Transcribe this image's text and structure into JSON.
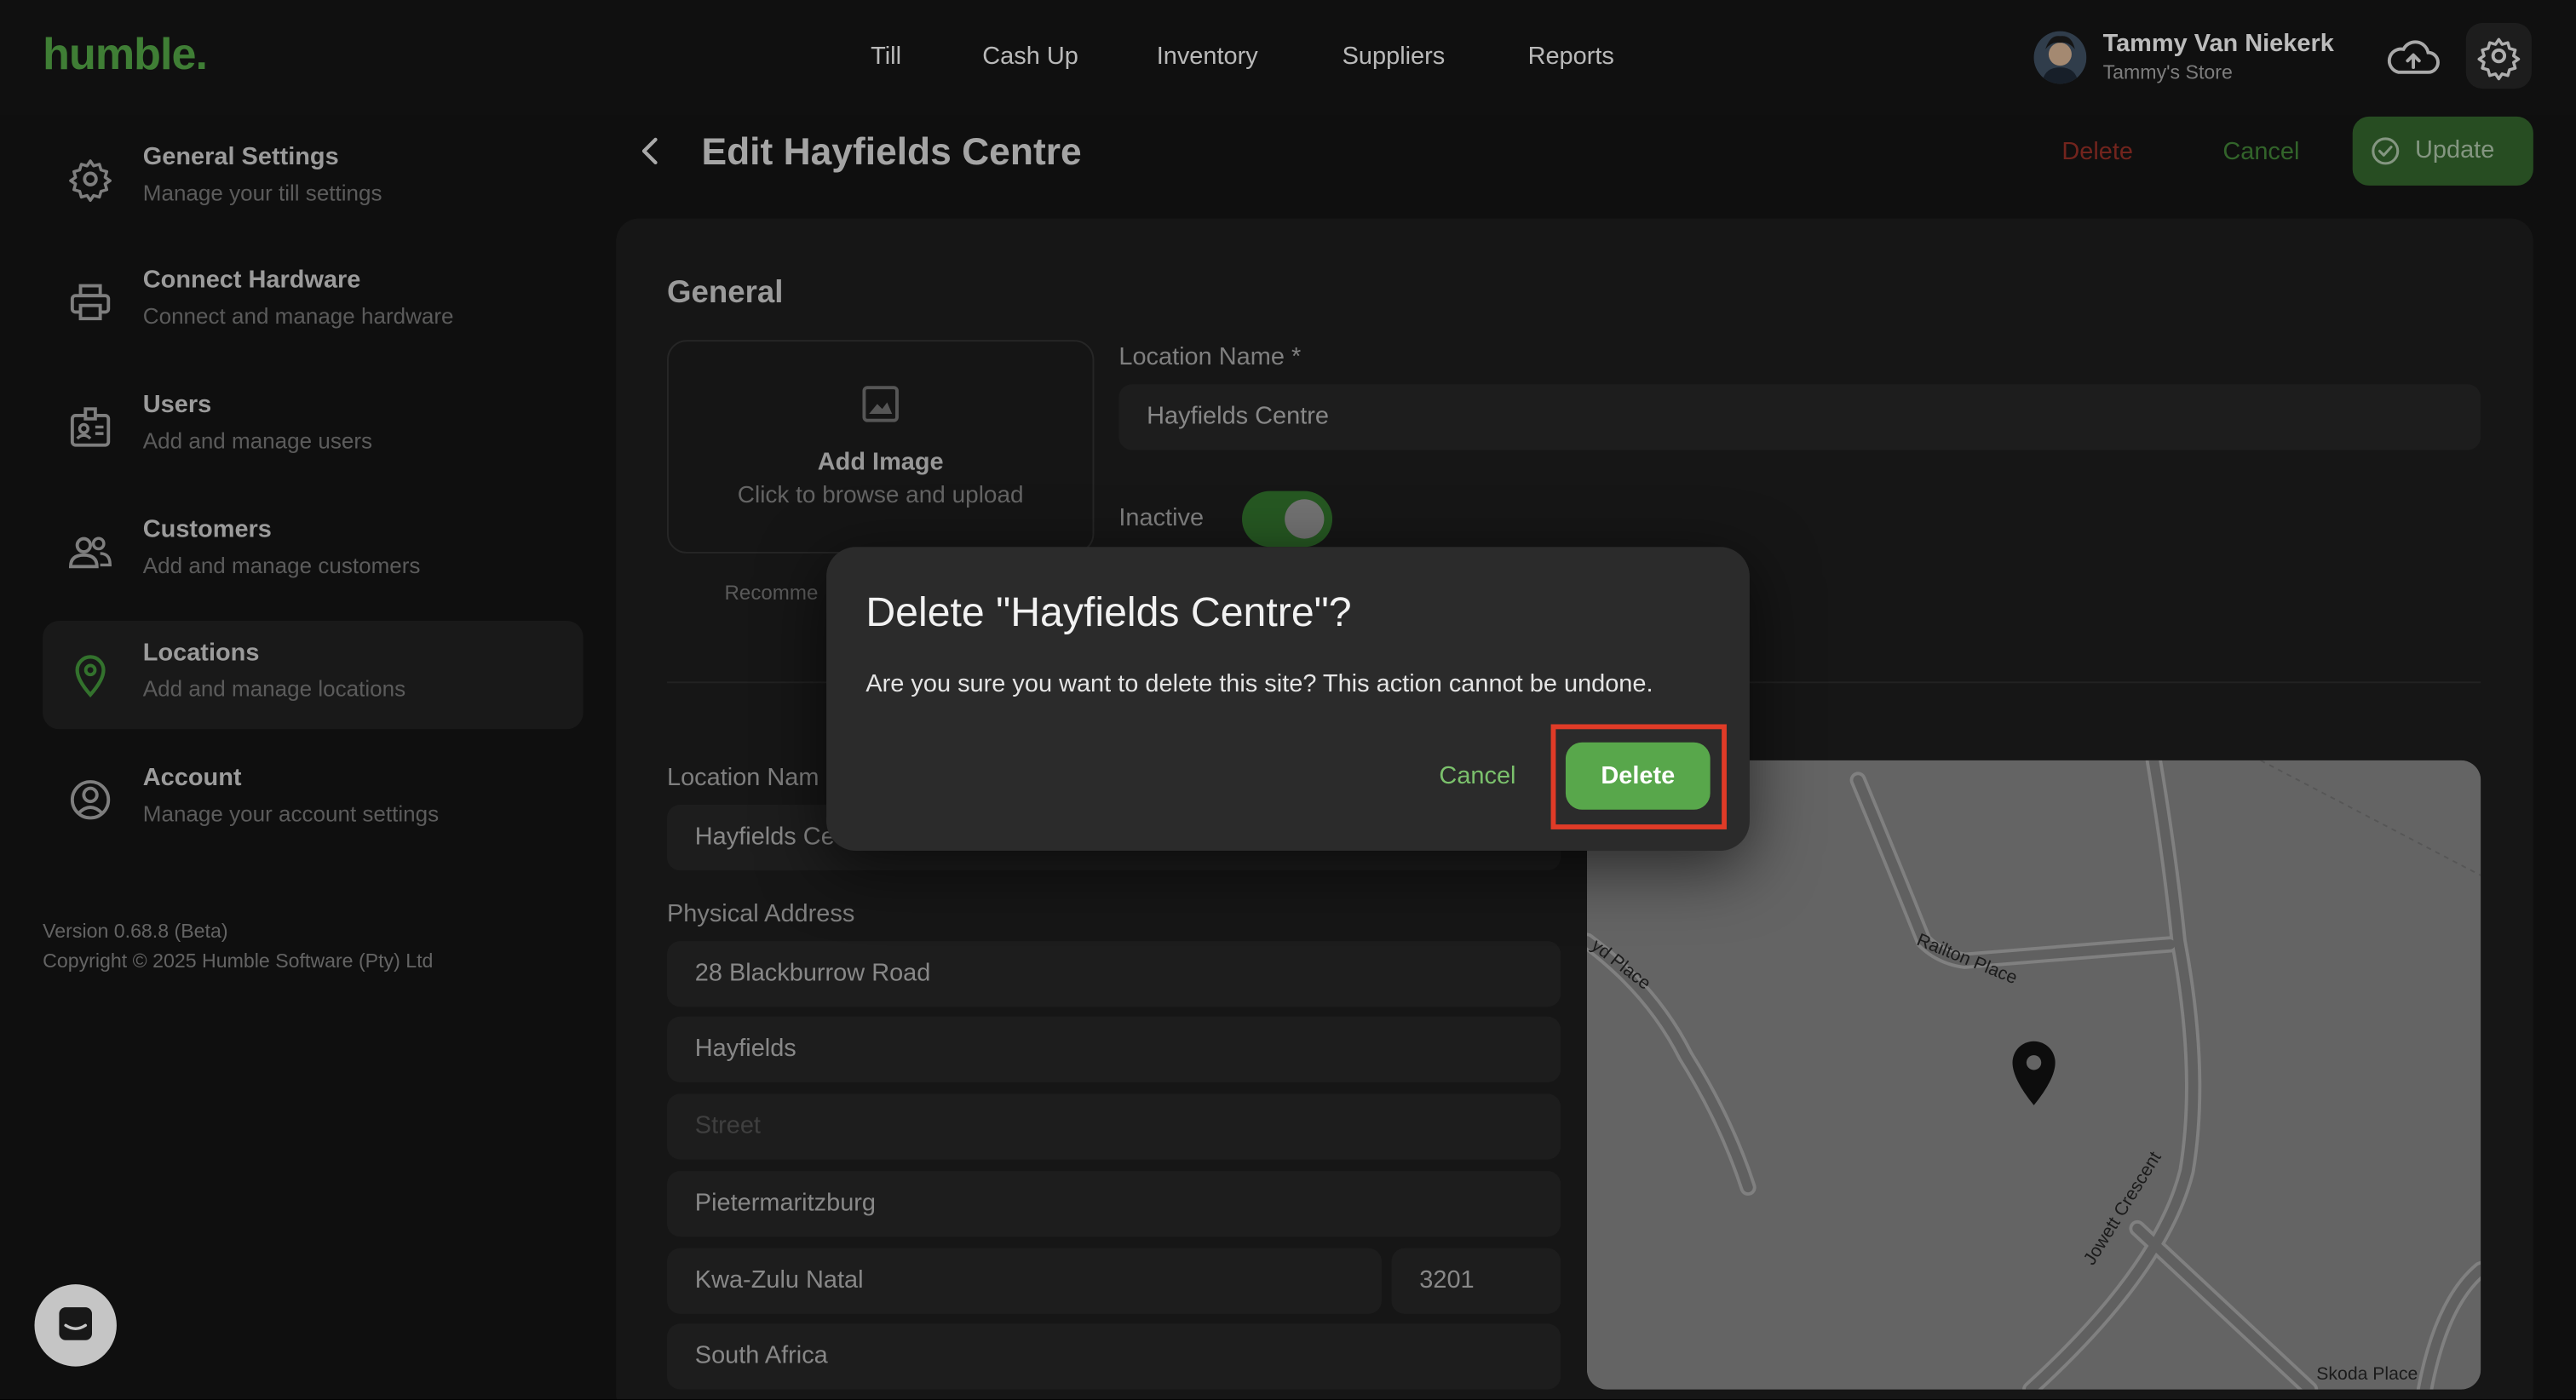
{
  "app": {
    "logo": "humble."
  },
  "nav": {
    "items": [
      "Till",
      "Cash Up",
      "Inventory",
      "Suppliers",
      "Reports"
    ]
  },
  "user": {
    "name": "Tammy Van Niekerk",
    "store": "Tammy's Store"
  },
  "sidebar": {
    "items": [
      {
        "title": "General Settings",
        "subtitle": "Manage your till settings",
        "icon": "gear-icon"
      },
      {
        "title": "Connect Hardware",
        "subtitle": "Connect and manage hardware",
        "icon": "printer-icon"
      },
      {
        "title": "Users",
        "subtitle": "Add and manage users",
        "icon": "id-card-icon"
      },
      {
        "title": "Customers",
        "subtitle": "Add and manage customers",
        "icon": "people-icon"
      },
      {
        "title": "Locations",
        "subtitle": "Add and manage locations",
        "icon": "location-pin-icon",
        "active": true
      },
      {
        "title": "Account",
        "subtitle": "Manage your account settings",
        "icon": "user-circle-icon"
      }
    ],
    "version": "Version 0.68.8 (Beta)",
    "copyright": "Copyright © 2025 Humble Software (Pty) Ltd"
  },
  "page": {
    "title": "Edit Hayfields Centre",
    "delete_label": "Delete",
    "cancel_label": "Cancel",
    "update_label": "Update"
  },
  "general": {
    "section_title": "General",
    "image_title": "Add Image",
    "image_subtitle": "Click to browse and upload",
    "recommend_text": "Recomme",
    "location_name_label": "Location Name *",
    "location_name_value": "Hayfields Centre",
    "inactive_label": "Inactive",
    "inactive_toggle": "on"
  },
  "details": {
    "location_name_label": "Location Nam",
    "location_name_value": "Hayfields Ce",
    "physical_address_label": "Physical Address",
    "address_line1": "28 Blackburrow Road",
    "suburb": "Hayfields",
    "street_placeholder": "Street",
    "city": "Pietermaritzburg",
    "province": "Kwa-Zulu Natal",
    "postal_code": "3201",
    "country": "South Africa"
  },
  "map": {
    "streets": [
      "Railton Place",
      "yd Place",
      "Jowett Crescent",
      "Skoda Place"
    ]
  },
  "dialog": {
    "title": "Delete \"Hayfields Centre\"?",
    "message": "Are you sure you want to delete this site? This action cannot be undone.",
    "cancel_label": "Cancel",
    "delete_label": "Delete"
  },
  "colors": {
    "brand_green": "#4e9a41",
    "danger_red": "#e03b27",
    "dialog_delete": "#58a74b"
  }
}
